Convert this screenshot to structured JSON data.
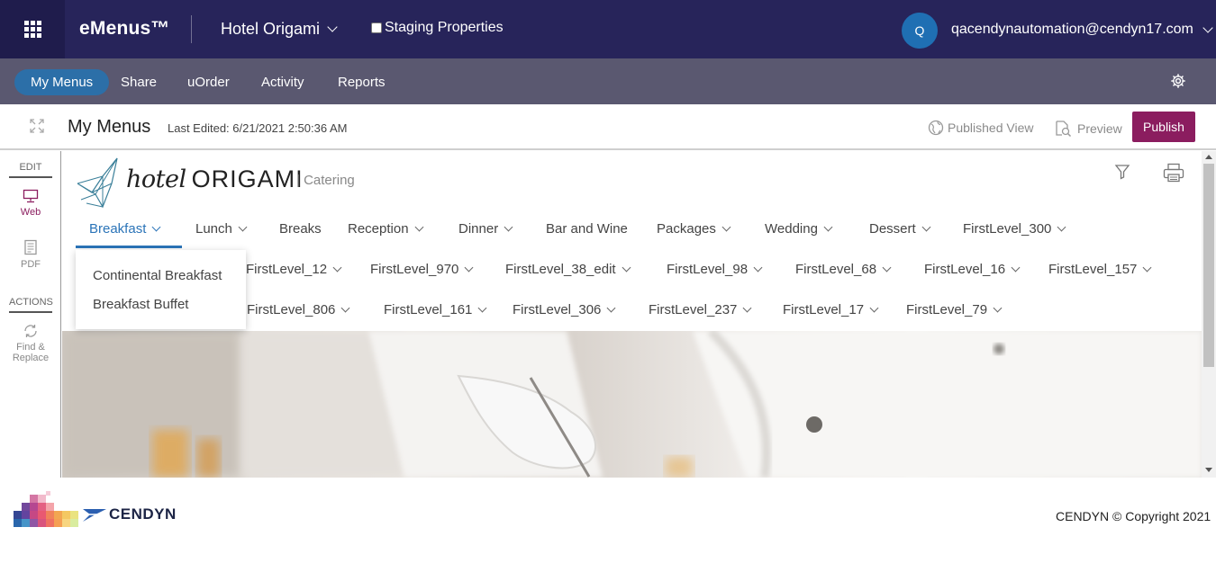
{
  "topbar": {
    "brand": "eMenus™",
    "property": "Hotel Origami",
    "staging_label": "Staging Properties",
    "avatar_initial": "Q",
    "user_email": "qacendynautomation@cendyn17.com"
  },
  "nav": {
    "items": [
      "My Menus",
      "Share",
      "uOrder",
      "Activity",
      "Reports"
    ],
    "active": "My Menus"
  },
  "titlebar": {
    "title": "My Menus",
    "last_edited": "Last Edited: 6/21/2021 2:50:36 AM",
    "published_view": "Published View",
    "preview": "Preview",
    "publish": "Publish"
  },
  "lefttool": {
    "edit_heading": "EDIT",
    "web": "Web",
    "pdf": "PDF",
    "actions_heading": "ACTIONS",
    "find_replace_1": "Find &",
    "find_replace_2": "Replace"
  },
  "menu_header": {
    "logo_word1": "hotel",
    "logo_word2": "ORIGAMI",
    "subtitle": "| Catering"
  },
  "menu_tabs": {
    "row1": [
      "Breakfast",
      "Lunch",
      "Breaks",
      "Reception",
      "Dinner",
      "Bar and Wine",
      "Packages",
      "Wedding",
      "Dessert",
      "FirstLevel_300"
    ],
    "row2": [
      "FirstLevel_12",
      "FirstLevel_970",
      "FirstLevel_38_edit",
      "FirstLevel_98",
      "FirstLevel_68",
      "FirstLevel_16",
      "FirstLevel_157"
    ],
    "row3": [
      "FirstLevel_806",
      "FirstLevel_161",
      "FirstLevel_306",
      "FirstLevel_237",
      "FirstLevel_17",
      "FirstLevel_79"
    ],
    "active": "Breakfast"
  },
  "dropdown": {
    "items": [
      "Continental Breakfast",
      "Breakfast Buffet"
    ]
  },
  "footer": {
    "brand": "CENDYN",
    "copyright": "CENDYN © Copyright 2021"
  },
  "colors": {
    "topbar": "#27245a",
    "navbar": "#5a5870",
    "active_nav": "#2c6fa8",
    "publish": "#8b1d5f",
    "active_tab": "#2b74b8"
  }
}
